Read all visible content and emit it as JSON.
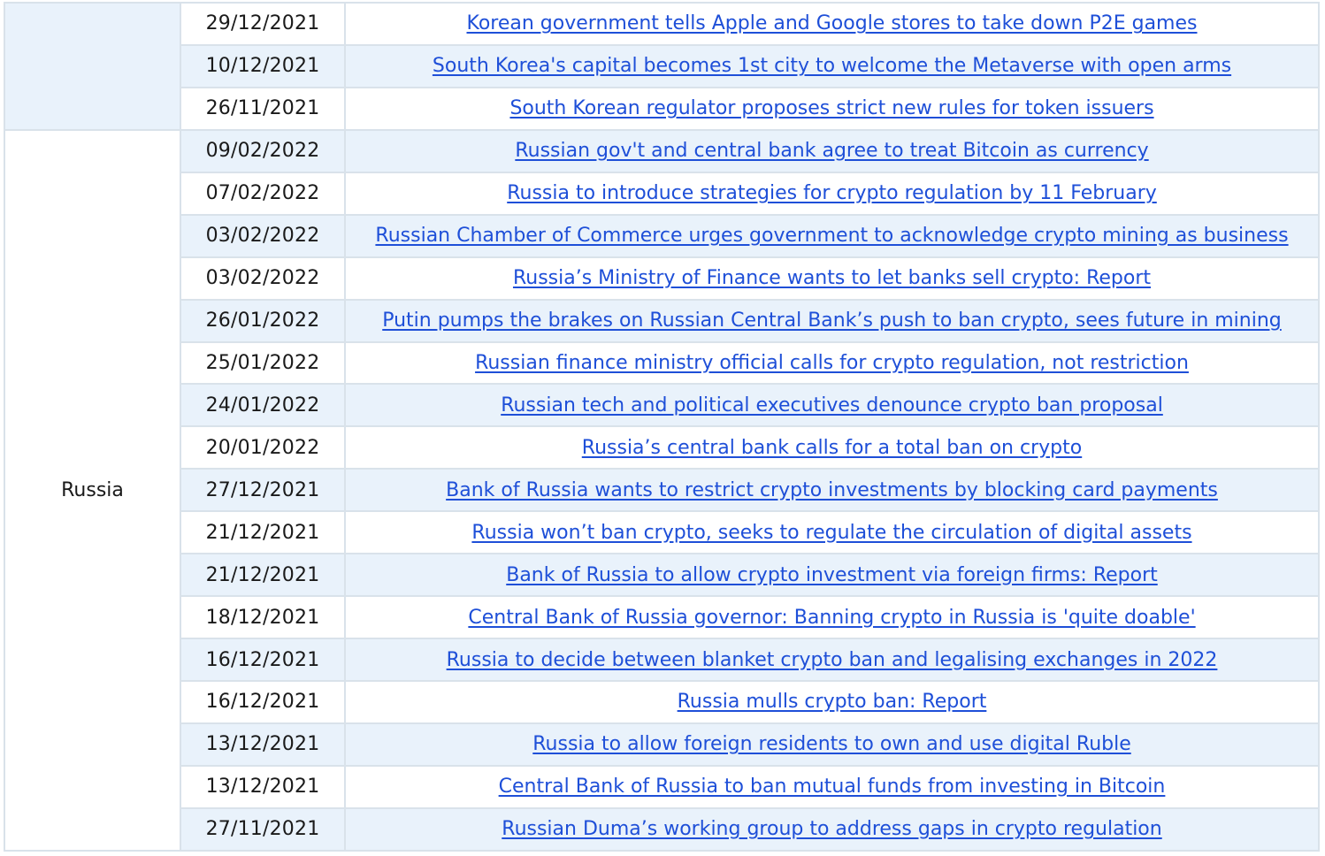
{
  "groups": [
    {
      "country": "",
      "rows": [
        {
          "date": "29/12/2021",
          "title": "Korean government tells Apple and Google stores to take down P2E games"
        },
        {
          "date": "10/12/2021",
          "title": "South Korea's capital becomes 1st city to welcome the Metaverse with open arms"
        },
        {
          "date": "26/11/2021",
          "title": "South Korean regulator proposes strict new rules for token issuers"
        }
      ]
    },
    {
      "country": "Russia",
      "rows": [
        {
          "date": "09/02/2022",
          "title": "Russian gov't and central bank agree to treat Bitcoin as currency"
        },
        {
          "date": "07/02/2022",
          "title": "Russia to introduce strategies for crypto regulation by 11 February"
        },
        {
          "date": "03/02/2022",
          "title": "Russian Chamber of Commerce urges government to acknowledge crypto mining as business"
        },
        {
          "date": "03/02/2022",
          "title": "Russia’s Ministry of Finance wants to let banks sell crypto: Report"
        },
        {
          "date": "26/01/2022",
          "title": "Putin pumps the brakes on Russian Central Bank’s push to ban crypto, sees future in mining"
        },
        {
          "date": "25/01/2022",
          "title": "Russian finance ministry official calls for crypto regulation, not restriction"
        },
        {
          "date": "24/01/2022",
          "title": "Russian tech and political executives denounce crypto ban proposal"
        },
        {
          "date": "20/01/2022",
          "title": "Russia’s central bank calls for a total ban on crypto"
        },
        {
          "date": "27/12/2021",
          "title": "Bank of Russia wants to restrict crypto investments by blocking card payments"
        },
        {
          "date": "21/12/2021",
          "title": "Russia won’t ban crypto, seeks to regulate the circulation of digital assets"
        },
        {
          "date": "21/12/2021",
          "title": "Bank of Russia to allow crypto investment via foreign firms: Report"
        },
        {
          "date": "18/12/2021",
          "title": "Central Bank of Russia governor: Banning crypto in Russia is 'quite doable'"
        },
        {
          "date": "16/12/2021",
          "title": "Russia to decide between blanket crypto ban and legalising exchanges in 2022"
        },
        {
          "date": "16/12/2021",
          "title": "Russia mulls crypto ban: Report"
        },
        {
          "date": "13/12/2021",
          "title": "Russia to allow foreign residents to own and use digital Ruble"
        },
        {
          "date": "13/12/2021",
          "title": "Central Bank of Russia to ban mutual funds from investing in Bitcoin"
        },
        {
          "date": "27/11/2021",
          "title": "Russian Duma’s working group to address gaps in crypto regulation"
        }
      ]
    }
  ],
  "colors": {
    "link": "#1e4fd8",
    "row_shade": "#e9f2fb",
    "border": "#d9e2ea"
  }
}
